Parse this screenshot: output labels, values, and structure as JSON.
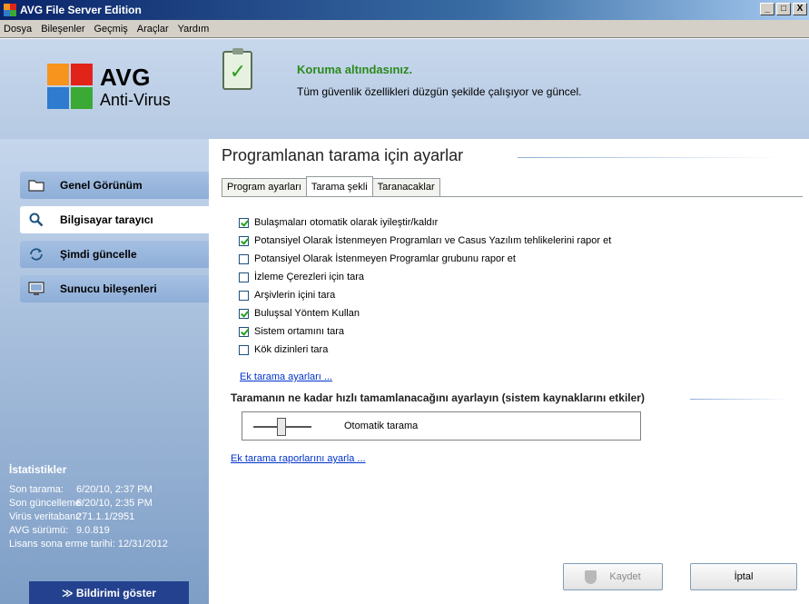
{
  "window": {
    "title": "AVG File Server Edition",
    "min": "_",
    "max": "□",
    "close": "X"
  },
  "menu": [
    "Dosya",
    "Bileşenler",
    "Geçmiş",
    "Araçlar",
    "Yardım"
  ],
  "logo": {
    "name": "AVG",
    "product": "Anti-Virus"
  },
  "status": {
    "title": "Koruma altındasınız.",
    "description": "Tüm güvenlik özellikleri düzgün şekilde çalışıyor ve güncel."
  },
  "sidebar": {
    "items": [
      {
        "label": "Genel Görünüm",
        "icon": "folder-icon"
      },
      {
        "label": "Bilgisayar tarayıcı",
        "icon": "magnifier-icon"
      },
      {
        "label": "Şimdi güncelle",
        "icon": "update-icon"
      },
      {
        "label": "Sunucu bileşenleri",
        "icon": "monitor-icon"
      }
    ],
    "stats_title": "İstatistikler",
    "stats": [
      {
        "key": "Son tarama:",
        "value": "6/20/10, 2:37 PM"
      },
      {
        "key": "Son güncelleme:",
        "value": "6/20/10, 2:35 PM"
      },
      {
        "key": "Virüs veritabanı:",
        "value": "271.1.1/2951"
      },
      {
        "key": "AVG sürümü:",
        "value": "9.0.819"
      },
      {
        "key": "Lisans sona erme tarihi:",
        "value": "12/31/2012"
      }
    ],
    "notify_button": "≫ Bildirimi göster"
  },
  "main": {
    "title": "Programlanan tarama için ayarlar",
    "tabs": [
      "Program ayarları",
      "Tarama şekli",
      "Taranacaklar"
    ],
    "active_tab": 1,
    "options": [
      {
        "label": "Bulaşmaları otomatik olarak iyileştir/kaldır",
        "checked": true
      },
      {
        "label": "Potansiyel Olarak İstenmeyen Programları ve Casus Yazılım tehlikelerini rapor et",
        "checked": true
      },
      {
        "label": "Potansiyel Olarak İstenmeyen Programlar grubunu rapor et",
        "checked": false
      },
      {
        "label": "İzleme Çerezleri için tara",
        "checked": false
      },
      {
        "label": "Arşivlerin içini tara",
        "checked": false
      },
      {
        "label": "Buluşsal Yöntem Kullan",
        "checked": true
      },
      {
        "label": "Sistem ortamını tara",
        "checked": true
      },
      {
        "label": "Kök dizinleri tara",
        "checked": false
      }
    ],
    "extra_settings_link": "Ek tarama ayarları ...",
    "speed_title": "Taramanın ne kadar hızlı tamamlanacağını ayarlayın (sistem kaynaklarını etkiler)",
    "speed_label": "Otomatik tarama",
    "report_link": "Ek tarama raporlarını ayarla ...",
    "save_button": "Kaydet",
    "cancel_button": "İptal"
  },
  "colors": {
    "status_green": "#2b8a1c",
    "link": "#0033cc",
    "sidebar_dark": "#23418e"
  }
}
